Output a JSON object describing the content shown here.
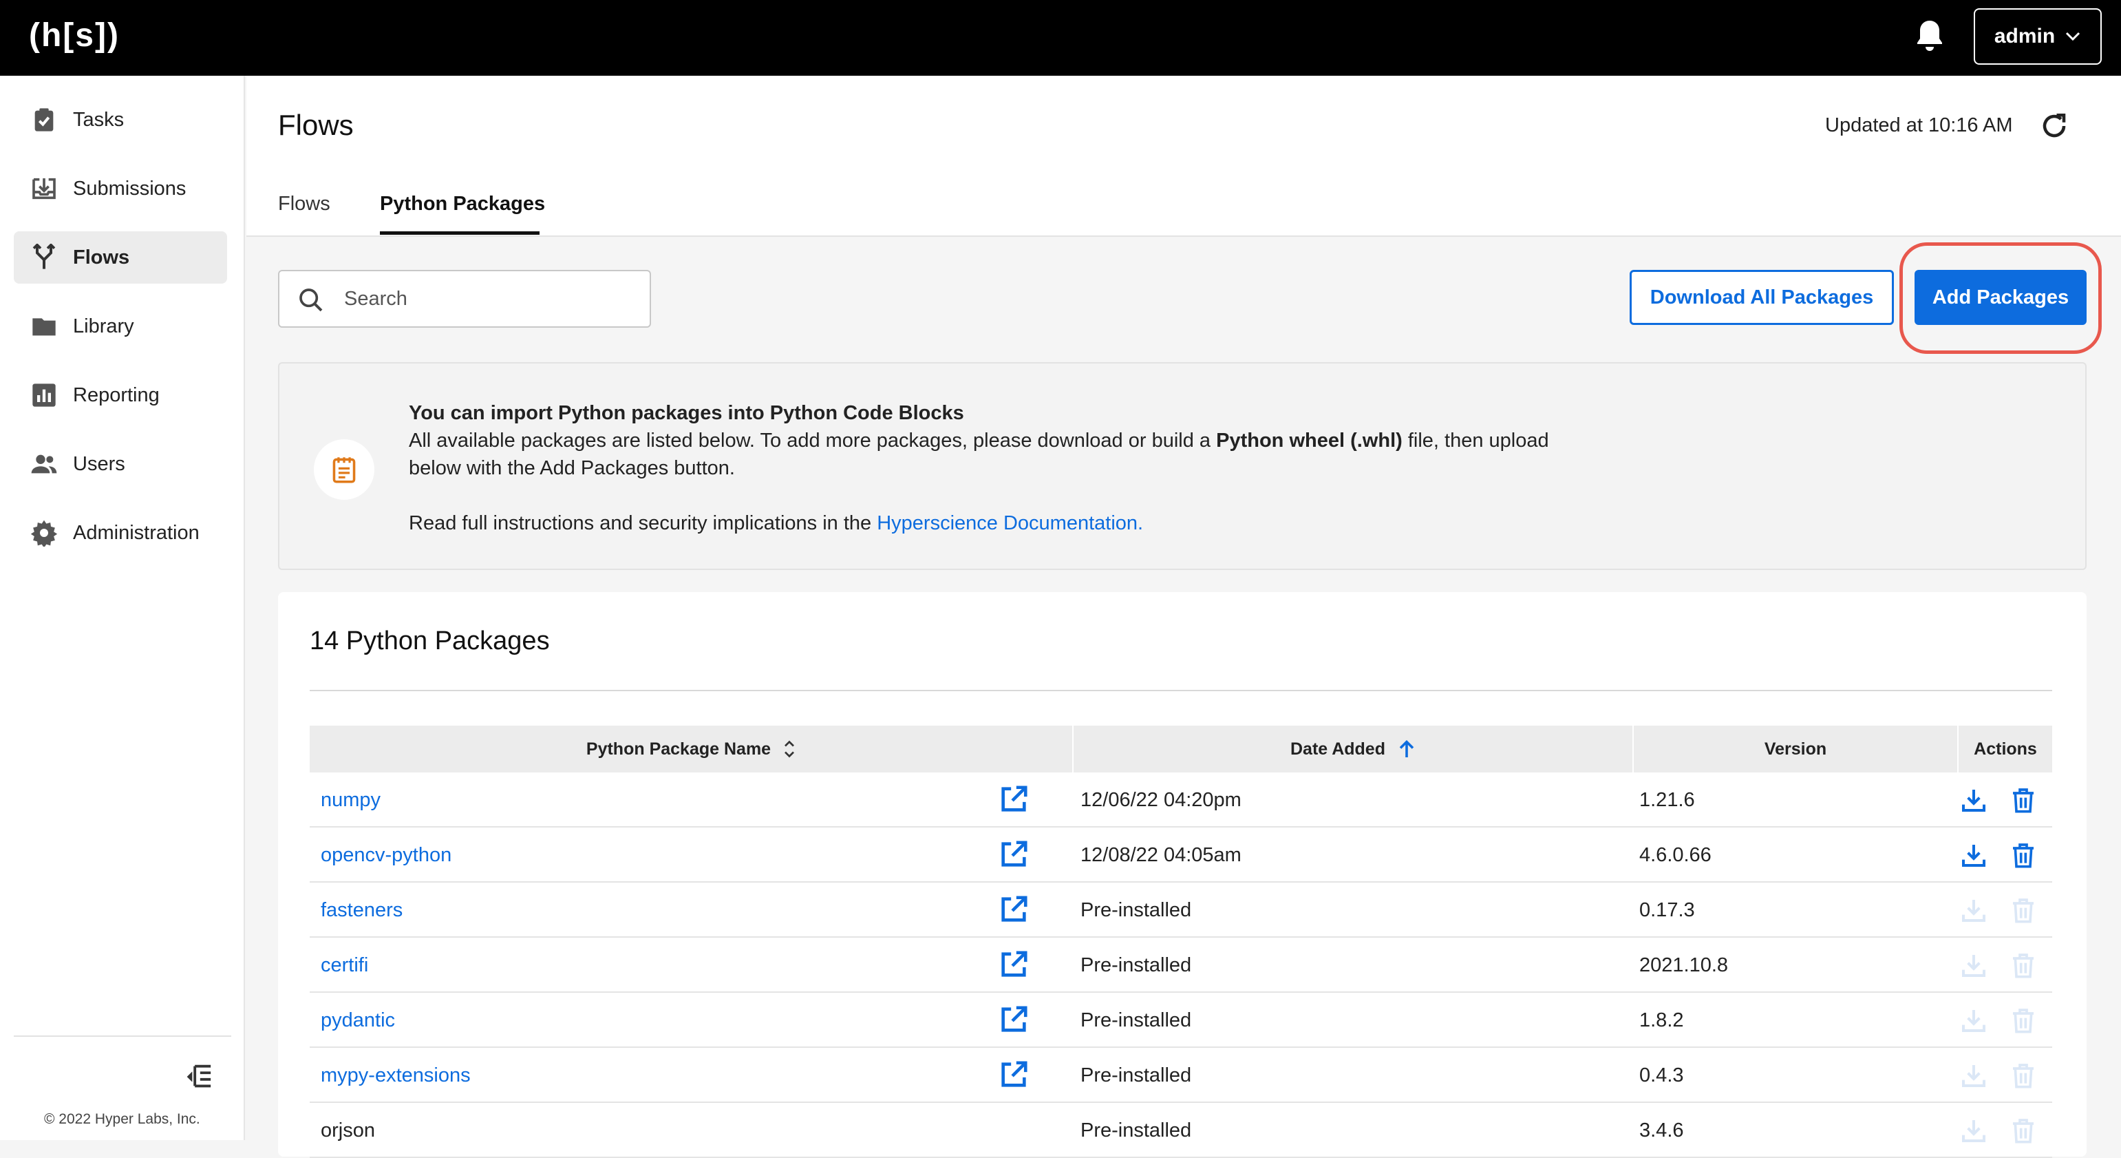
{
  "topbar": {
    "logo": "(h[s])",
    "user_menu_label": "admin"
  },
  "sidebar": {
    "items": [
      {
        "label": "Tasks",
        "icon": "clipboard-check-icon"
      },
      {
        "label": "Submissions",
        "icon": "tray-download-icon"
      },
      {
        "label": "Flows",
        "icon": "flow-branch-icon",
        "active": true
      },
      {
        "label": "Library",
        "icon": "folder-icon"
      },
      {
        "label": "Reporting",
        "icon": "bar-chart-icon"
      },
      {
        "label": "Users",
        "icon": "users-icon"
      },
      {
        "label": "Administration",
        "icon": "gear-icon"
      }
    ],
    "copyright": "© 2022 Hyper Labs, Inc."
  },
  "header": {
    "title": "Flows",
    "updated": "Updated at 10:16 AM",
    "tabs": [
      {
        "label": "Flows"
      },
      {
        "label": "Python Packages",
        "active": true
      }
    ]
  },
  "toolbar": {
    "search_placeholder": "Search",
    "download_all_label": "Download All Packages",
    "add_packages_label": "Add Packages"
  },
  "info": {
    "heading": "You can import Python packages into Python Code Blocks",
    "line1_prefix": "All available packages are listed below. To add more packages, please download or build a",
    "line1_bold": "Python wheel (.whl)",
    "line1_suffix": "file, then upload",
    "line2": "below with the Add Packages button.",
    "line3_prefix": "Read full instructions and security implications in the",
    "link": "Hyperscience Documentation."
  },
  "table": {
    "title": "14 Python Packages",
    "columns": {
      "name": "Python Package Name",
      "date": "Date Added",
      "version": "Version",
      "actions": "Actions"
    },
    "rows": [
      {
        "name": "numpy",
        "date": "12/06/22 04:20pm",
        "version": "1.21.6"
      },
      {
        "name": "opencv-python",
        "date": "12/08/22 04:05am",
        "version": "4.6.0.66"
      },
      {
        "name": "fasteners",
        "date": "Pre-installed",
        "version": "0.17.3"
      },
      {
        "name": "certifi",
        "date": "Pre-installed",
        "version": "2021.10.8"
      },
      {
        "name": "pydantic",
        "date": "Pre-installed",
        "version": "1.8.2"
      },
      {
        "name": "mypy-extensions",
        "date": "Pre-installed",
        "version": "0.4.3"
      },
      {
        "name": "orjson",
        "date": "Pre-installed",
        "version": "3.4.6"
      }
    ]
  },
  "colors": {
    "accent": "#0d6cde",
    "highlight": "#e8584d",
    "topbar": "#000000"
  }
}
